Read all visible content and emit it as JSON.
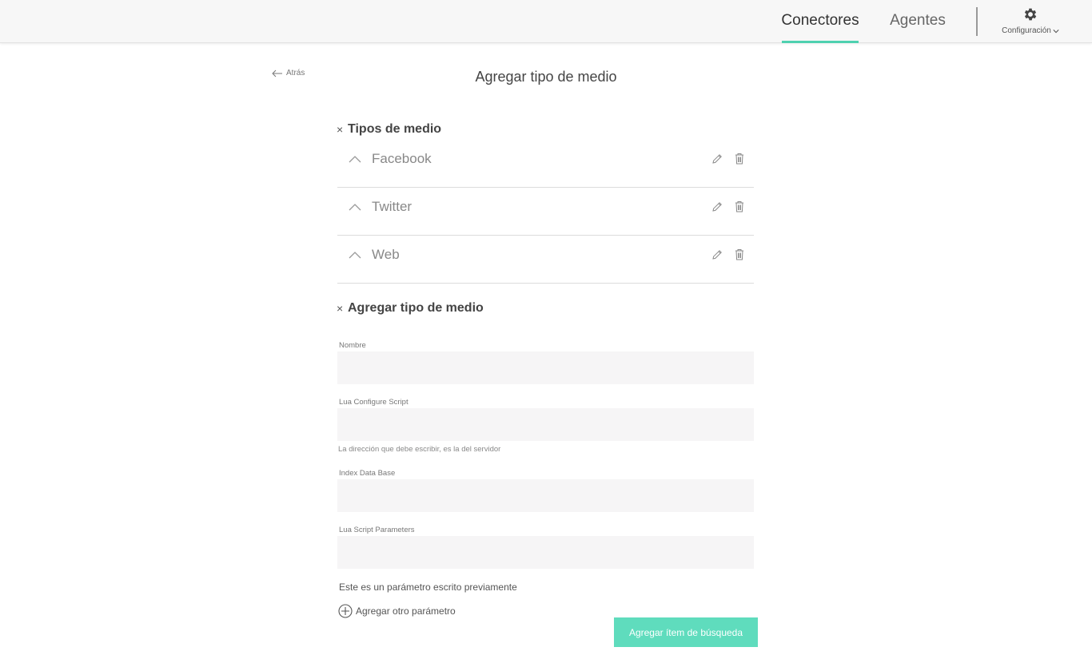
{
  "header": {
    "tabs": [
      {
        "label": "Conectores",
        "active": true
      },
      {
        "label": "Agentes",
        "active": false
      }
    ],
    "settings_label": "Configuración",
    "settings_icon": "gear-icon",
    "accent_color": "#4fd1b0"
  },
  "back_label": "Atrás",
  "page_title": "Agregar tipo de medio",
  "media_types": {
    "title": "Tipos de medio",
    "items": [
      {
        "name": "Facebook"
      },
      {
        "name": "Twitter"
      },
      {
        "name": "Web"
      }
    ]
  },
  "form": {
    "title": "Agregar tipo de medio",
    "fields": [
      {
        "label": "Nombre",
        "value": ""
      },
      {
        "label": "Lua Configure Script",
        "value": "",
        "hint": "La dirección que debe escribir, es la del servidor"
      },
      {
        "label": "Index Data Base",
        "value": ""
      },
      {
        "label": "Lua Script Parameters",
        "value": ""
      }
    ],
    "existing_param": "Este es un parámetro escrito previamente",
    "add_param_label": "Agregar otro parámetro",
    "submit_label": "Agregar ítem de búsqueda",
    "submit_color": "#5fdcbd"
  }
}
